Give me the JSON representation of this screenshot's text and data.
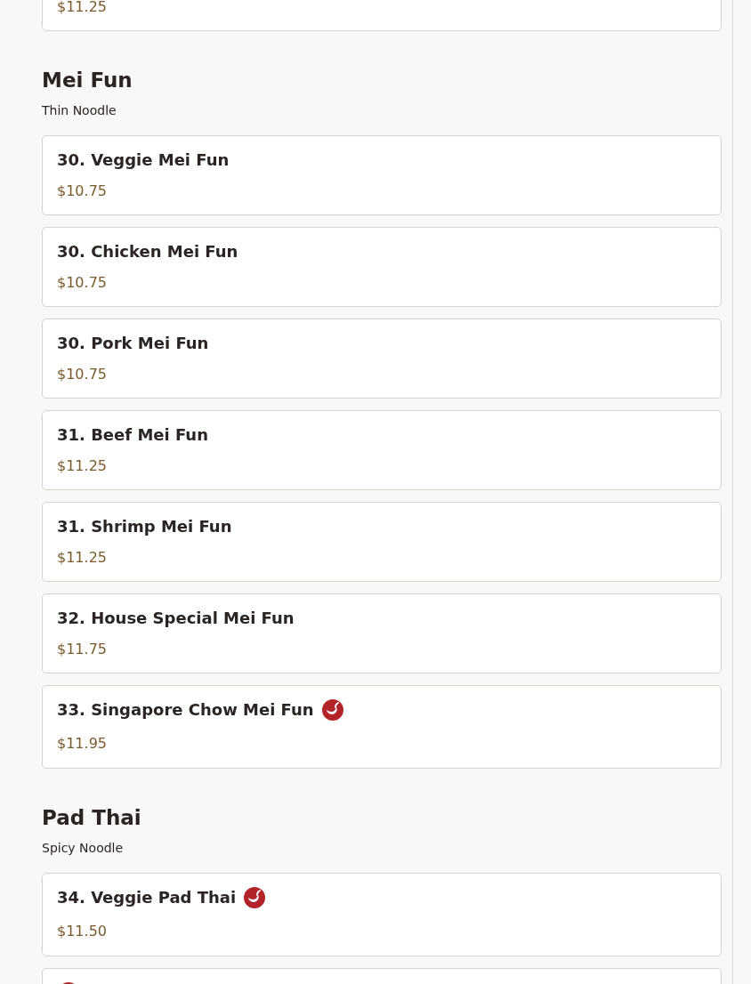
{
  "sections": [
    {
      "items": [
        {
          "price": "$11.25",
          "spicy": false
        }
      ]
    },
    {
      "title": "Mei Fun",
      "subtitle": "Thin Noodle",
      "items": [
        {
          "name": "30. Veggie Mei Fun",
          "price": "$10.75",
          "spicy": false
        },
        {
          "name": "30. Chicken Mei Fun",
          "price": "$10.75",
          "spicy": false
        },
        {
          "name": "30. Pork Mei Fun",
          "price": "$10.75",
          "spicy": false
        },
        {
          "name": "31. Beef Mei Fun",
          "price": "$11.25",
          "spicy": false
        },
        {
          "name": "31. Shrimp Mei Fun",
          "price": "$11.25",
          "spicy": false
        },
        {
          "name": "32. House Special Mei Fun",
          "price": "$11.75",
          "spicy": false
        },
        {
          "name": "33. Singapore Chow Mei Fun",
          "price": "$11.95",
          "spicy": true
        }
      ]
    },
    {
      "title": "Pad Thai",
      "subtitle": "Spicy Noodle",
      "items": [
        {
          "name": "34. Veggie Pad Thai",
          "price": "$11.50",
          "spicy": true
        },
        {
          "spicy": true
        }
      ]
    }
  ]
}
